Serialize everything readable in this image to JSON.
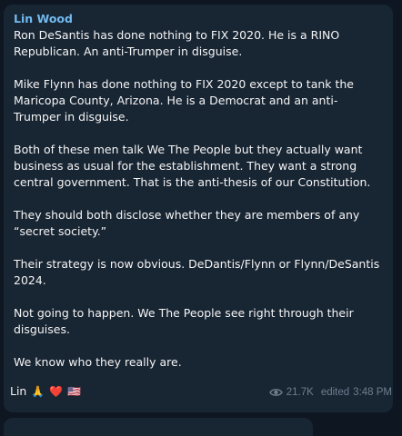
{
  "message": {
    "author": "Lin Wood",
    "paragraphs": [
      "Ron DeSantis has done nothing to FIX 2020. He is a RINO Republican. An anti-Trumper in disguise.",
      "Mike Flynn has done nothing to FIX 2020 except to tank the Maricopa County, Arizona. He is a Democrat and an anti-Trumper in disguise.",
      "Both of these men talk We The People but they actually want business as usual for the establishment. They want a strong central government. That is the anti-thesis of our Constitution.",
      "They should both disclose whether they are members of any “secret society.”",
      "Their strategy is now obvious. DeDantis/Flynn or Flynn/DeSantis 2024.",
      "Not going to happen. We The People see right through their disguises.",
      "We know who they really are."
    ],
    "signature": "Lin",
    "signature_emojis": [
      "🙏",
      "❤️",
      "🇺🇸"
    ],
    "views": "21.7K",
    "edited_label": "edited",
    "time": "3:48 PM"
  },
  "icons": {
    "views": "eye-icon"
  },
  "colors": {
    "background": "#0e1621",
    "bubble": "#182533",
    "author": "#71baf0",
    "text": "#f5f5f5",
    "meta": "#6d7f8f"
  }
}
